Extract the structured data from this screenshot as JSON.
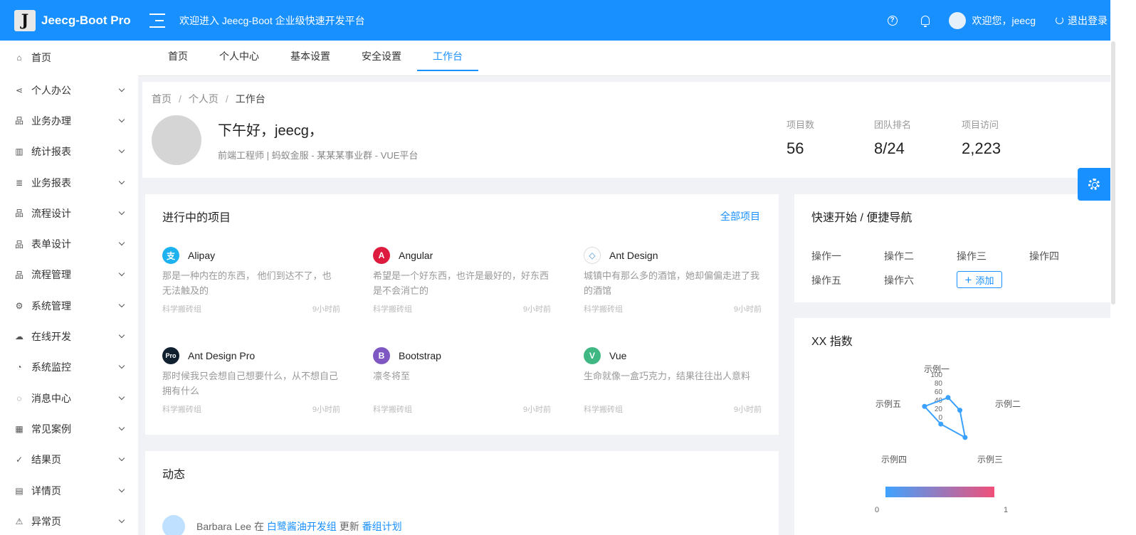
{
  "header": {
    "logo_letter": "J",
    "app_name": "Jeecg-Boot Pro",
    "welcome": "欢迎进入 Jeecg-Boot 企业级快速开发平台",
    "help_icon": "question-circle-icon",
    "bell_icon": "bell-icon",
    "user_greeting": "欢迎您，jeecg",
    "logout_label": "退出登录"
  },
  "sidebar": {
    "items": [
      {
        "label": "首页",
        "icon": "home-icon",
        "expandable": false
      },
      {
        "label": "个人办公",
        "icon": "share-icon",
        "expandable": true
      },
      {
        "label": "业务办理",
        "icon": "cluster-icon",
        "expandable": true
      },
      {
        "label": "统计报表",
        "icon": "bar-chart-icon",
        "expandable": true
      },
      {
        "label": "业务报表",
        "icon": "sliders-icon",
        "expandable": true
      },
      {
        "label": "流程设计",
        "icon": "cluster-icon",
        "expandable": true
      },
      {
        "label": "表单设计",
        "icon": "apartment-icon",
        "expandable": true
      },
      {
        "label": "流程管理",
        "icon": "cluster-icon",
        "expandable": true
      },
      {
        "label": "系统管理",
        "icon": "setting-icon",
        "expandable": true
      },
      {
        "label": "在线开发",
        "icon": "cloud-icon",
        "expandable": true
      },
      {
        "label": "系统监控",
        "icon": "dashboard-icon",
        "expandable": true
      },
      {
        "label": "消息中心",
        "icon": "message-icon",
        "expandable": true
      },
      {
        "label": "常见案例",
        "icon": "qrcode-icon",
        "expandable": true
      },
      {
        "label": "结果页",
        "icon": "check-circle-icon",
        "expandable": true
      },
      {
        "label": "详情页",
        "icon": "profile-icon",
        "expandable": true
      },
      {
        "label": "异常页",
        "icon": "warning-icon",
        "expandable": true
      }
    ]
  },
  "tabs": [
    {
      "label": "首页",
      "active": false
    },
    {
      "label": "个人中心",
      "active": false
    },
    {
      "label": "基本设置",
      "active": false
    },
    {
      "label": "安全设置",
      "active": false
    },
    {
      "label": "工作台",
      "active": true
    }
  ],
  "breadcrumb": [
    "首页",
    "个人页",
    "工作台"
  ],
  "profile": {
    "greeting": "下午好，jeecg，",
    "subtitle": "前端工程师 | 蚂蚁金服 - 某某某事业群 - VUE平台"
  },
  "stats": [
    {
      "label": "项目数",
      "value": "56"
    },
    {
      "label": "团队排名",
      "value": "8/24"
    },
    {
      "label": "项目访问",
      "value": "2,223"
    }
  ],
  "projects": {
    "title": "进行中的项目",
    "link": "全部项目",
    "items": [
      {
        "name": "Alipay",
        "desc": "那是一种内在的东西， 他们到达不了，也无法触及的",
        "group": "科学搬砖组",
        "time": "9小时前",
        "icon": "alipay-icon",
        "color": "#1cb2f0",
        "glyph": "支"
      },
      {
        "name": "Angular",
        "desc": "希望是一个好东西，也许是最好的，好东西是不会消亡的",
        "group": "科学搬砖组",
        "time": "9小时前",
        "icon": "angular-icon",
        "color": "#dd1b3e",
        "glyph": "A"
      },
      {
        "name": "Ant Design",
        "desc": "城镇中有那么多的酒馆，她却偏偏走进了我的酒馆",
        "group": "科学搬砖组",
        "time": "9小时前",
        "icon": "ant-design-icon",
        "color": "#ffffff",
        "glyph": "◇"
      },
      {
        "name": "Ant Design Pro",
        "desc": "那时候我只会想自己想要什么，从不想自己拥有什么",
        "group": "科学搬砖组",
        "time": "9小时前",
        "icon": "ant-design-pro-icon",
        "color": "#10202f",
        "glyph": "Pro"
      },
      {
        "name": "Bootstrap",
        "desc": "凛冬将至",
        "group": "科学搬砖组",
        "time": "9小时前",
        "icon": "bootstrap-icon",
        "color": "#7e57c2",
        "glyph": "B"
      },
      {
        "name": "Vue",
        "desc": "生命就像一盒巧克力，结果往往出人意料",
        "group": "科学搬砖组",
        "time": "9小时前",
        "icon": "vue-icon",
        "color": "#3fb883",
        "glyph": "V"
      }
    ]
  },
  "activity": {
    "title": "动态",
    "user": "Barbara Lee",
    "verb1": "在",
    "group_link": "白鹭酱油开发组",
    "verb2": "更新",
    "target_link": "番组计划"
  },
  "quick_nav": {
    "title": "快速开始 / 便捷导航",
    "items": [
      "操作一",
      "操作二",
      "操作三",
      "操作四",
      "操作五",
      "操作六"
    ],
    "add_label": "添加"
  },
  "radar": {
    "title": "XX 指数",
    "legend_min": "0",
    "legend_max": "1",
    "gradient": [
      "#3fa3ff",
      "#f04f79"
    ]
  },
  "chart_data": {
    "type": "radar",
    "title": "XX 指数",
    "axes": [
      "示例一",
      "示例二",
      "示例三",
      "示例四",
      "示例五"
    ],
    "ticks": [
      0,
      20,
      40,
      60,
      80,
      100
    ],
    "values": [
      40,
      30,
      70,
      30,
      60
    ],
    "ylim": [
      0,
      100
    ]
  },
  "settings_icon": "gear-icon"
}
